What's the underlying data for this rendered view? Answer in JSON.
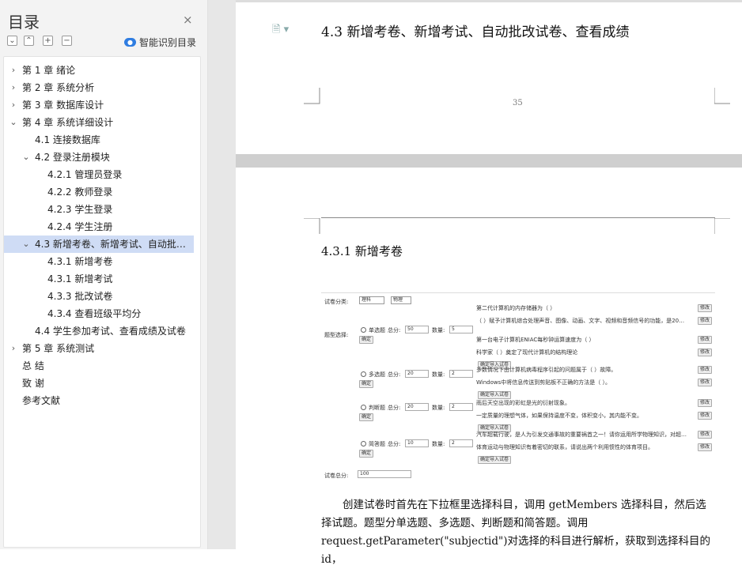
{
  "sidebar": {
    "title": "目录",
    "close": "×",
    "tools": [
      "⌄",
      "⌃",
      "+",
      "−"
    ],
    "smart_label": "智能识别目录",
    "items": [
      {
        "label": "第 1 章  绪论",
        "chev": "›",
        "level": 0
      },
      {
        "label": "第 2 章  系统分析",
        "chev": "›",
        "level": 0
      },
      {
        "label": "第 3 章  数据库设计",
        "chev": "›",
        "level": 0
      },
      {
        "label": "第 4 章  系统详细设计",
        "chev": "⌄",
        "level": 0
      },
      {
        "label": "4.1 连接数据库",
        "chev": "",
        "level": 1
      },
      {
        "label": "4.2  登录注册模块",
        "chev": "⌄",
        "level": 1
      },
      {
        "label": "4.2.1  管理员登录",
        "chev": "",
        "level": 2
      },
      {
        "label": "4.2.2 教师登录",
        "chev": "",
        "level": 2
      },
      {
        "label": "4.2.3  学生登录",
        "chev": "",
        "level": 2
      },
      {
        "label": "4.2.4   学生注册",
        "chev": "",
        "level": 2
      },
      {
        "label": "4.3 新增考卷、新增考试、自动批改试卷、查看成绩",
        "chev": "⌄",
        "level": 1,
        "selected": true
      },
      {
        "label": "4.3.1  新增考卷",
        "chev": "",
        "level": 2
      },
      {
        "label": "4.3.1  新增考试",
        "chev": "",
        "level": 2
      },
      {
        "label": "4.3.3  批改试卷",
        "chev": "",
        "level": 2
      },
      {
        "label": "4.3.4  查看班级平均分",
        "chev": "",
        "level": 2
      },
      {
        "label": "4.4 学生参加考试、查看成绩及试卷",
        "chev": "",
        "level": 1
      },
      {
        "label": "第 5 章  系统测试",
        "chev": "›",
        "level": 0
      },
      {
        "label": "总   结",
        "chev": "",
        "level": 0
      },
      {
        "label": "致   谢",
        "chev": "",
        "level": 0
      },
      {
        "label": "参考文献",
        "chev": "",
        "level": 0
      }
    ]
  },
  "document": {
    "heading_43": "4.3 新增考卷、新增考试、自动批改试卷、查看成绩",
    "page_number": "35",
    "heading_431": "4.3.1  新增考卷",
    "paragraph": [
      "创建试卷时首先在下拉框里选择科目，调用 getMembers 选择科目，然后选",
      "择试题。题型分单选题、多选题、判断题和简答题。调用",
      "request.getParameter(\"subjectid\")对选择的科目进行解析，获取到选择科目的 id，"
    ]
  },
  "screenshot": {
    "subject_label": "试卷分类:",
    "subject_value": "理科",
    "subject_value2": "物理",
    "type_label": "题型选择:",
    "score_label": "总分:",
    "count_label": "数量:",
    "confirm": "确定",
    "modify": "修改",
    "import": "确定导入试卷",
    "total_label": "试卷总分:",
    "total_value": "100",
    "groups": [
      {
        "name": "单选题",
        "score": "50",
        "count": "5",
        "questions": [
          "第二代计算机的内存储器为（ ）",
          "（ ）赋予计算机综合处理声音、图像、动画、文字、视频和音频信号的功能，是20世纪90年代计算机的时代特征",
          "第一台电子计算机ENIAC每秒钟运算速度为（ ）",
          "科学家（ ）奠定了现代计算机的结构理论"
        ]
      },
      {
        "name": "多选题",
        "score": "20",
        "count": "2",
        "questions": [
          "多数情况下由计算机病毒程序引起的问题属于（ ）故障。",
          "Windows中将信息传送到剪贴板不正确的方法是（ ）。"
        ]
      },
      {
        "name": "判断题",
        "score": "20",
        "count": "2",
        "questions": [
          "雨后天空出现的彩虹是光的衍射现象。",
          "一定质量的理想气体，如果保持温度不变，体积变小，其内能不变。"
        ]
      },
      {
        "name": "简答题",
        "score": "10",
        "count": "2",
        "questions": [
          "汽车超载行驶，是人为引发交通事故的重要祸首之一！请你运用所学物理知识，对超载行驶引发交通事故的现象，进行简要说明：",
          "体育运动与物理知识有着密切的联系，请说出两个利用惯性的体育项目。"
        ]
      }
    ]
  }
}
